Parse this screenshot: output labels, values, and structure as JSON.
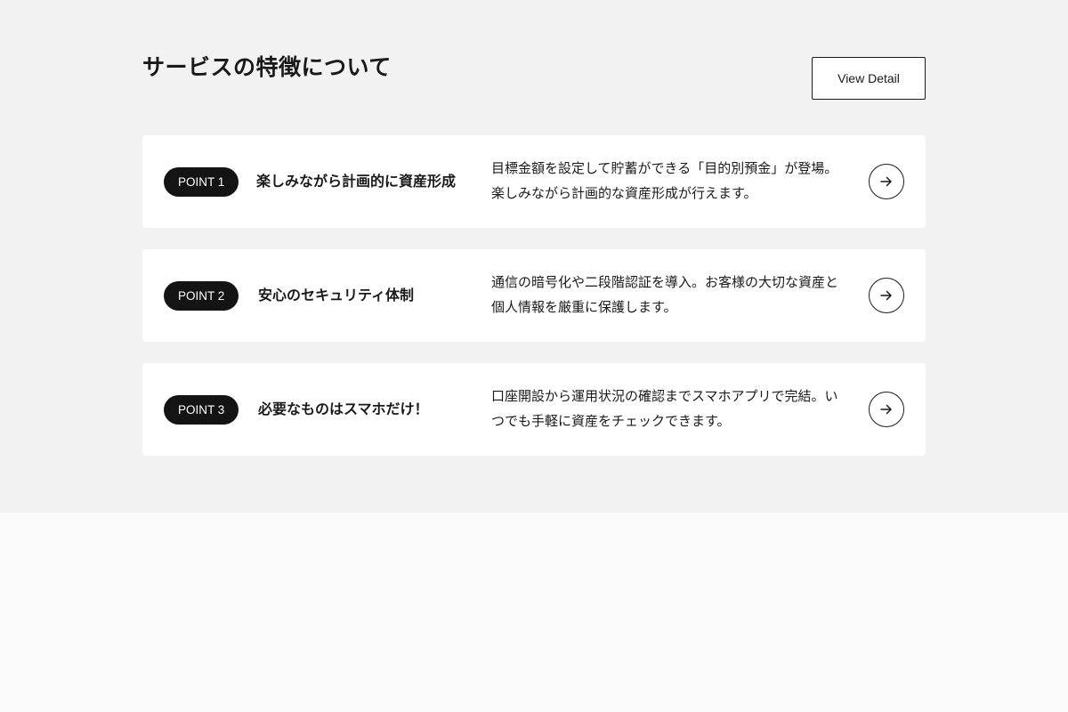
{
  "section": {
    "heading": "サービスの特徴について",
    "view_detail_label": "View Detail"
  },
  "points": [
    {
      "badge": "POINT 1",
      "title": "楽しみながら計画的に資産形成",
      "description": "目標金額を設定して貯蓄ができる「目的別預金」が登場。楽しみながら計画的な資産形成が行えます。",
      "action_icon": "arrow-right-icon"
    },
    {
      "badge": "POINT 2",
      "title": "安心のセキュリティ体制",
      "description": "通信の暗号化や二段階認証を導入。お客様の大切な資産と個人情報を厳重に保護します。",
      "action_icon": "arrow-right-icon"
    },
    {
      "badge": "POINT 3",
      "title": "必要なものはスマホだけ！",
      "description": "口座開設から運用状況の確認までスマホアプリで完結。いつでも手軽に資産をチェックできます。",
      "action_icon": "arrow-right-icon"
    }
  ],
  "colors": {
    "section_background": "#f2f2f2",
    "page_background": "#fbfbfb",
    "card_background": "#ffffff",
    "badge_background": "#141414",
    "text": "#1a1a1a"
  }
}
